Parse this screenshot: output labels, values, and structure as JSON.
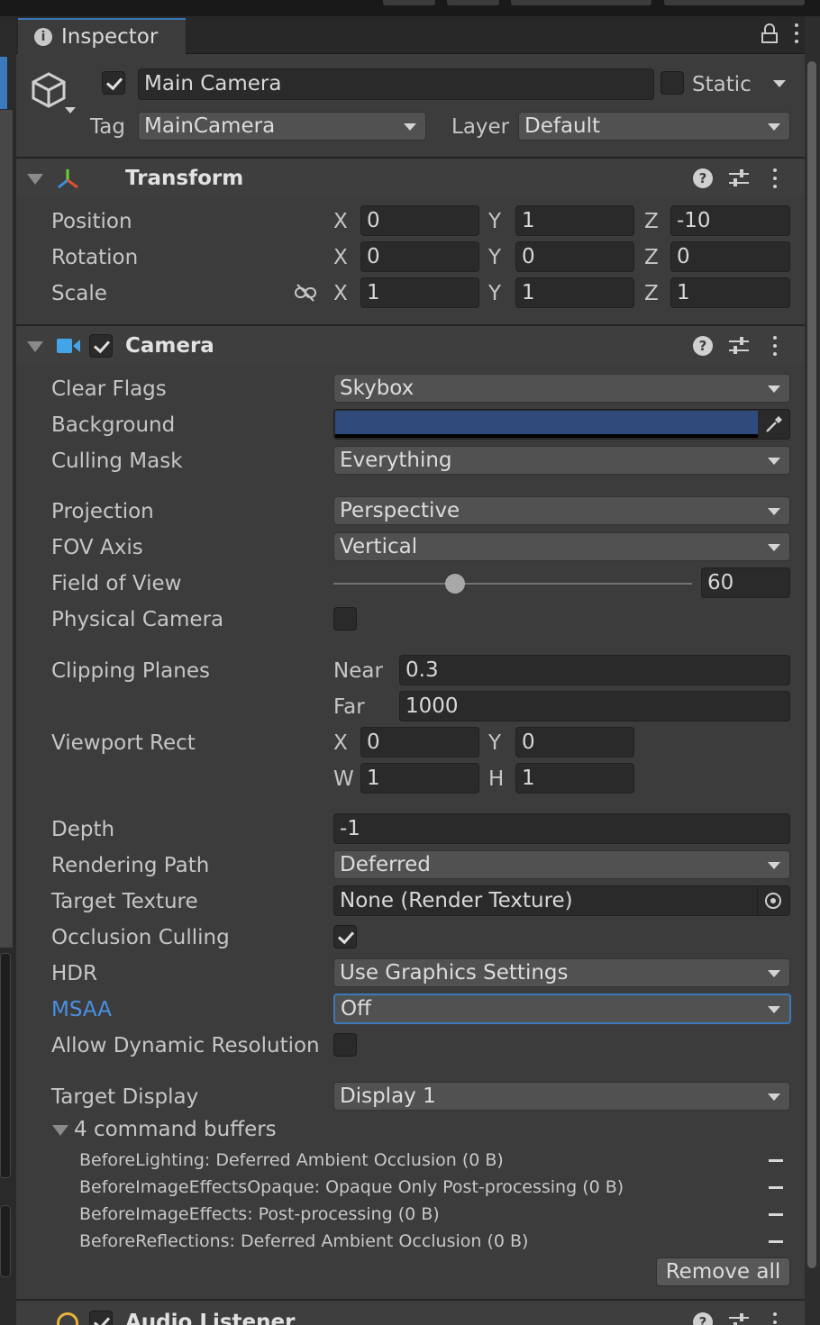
{
  "tab": {
    "label": "Inspector",
    "info_icon": "i"
  },
  "object": {
    "name": "Main Camera",
    "active": true,
    "static_label": "Static",
    "static": false,
    "tag_label": "Tag",
    "tag_value": "MainCamera",
    "layer_label": "Layer",
    "layer_value": "Default"
  },
  "transform": {
    "title": "Transform",
    "position": {
      "label": "Position",
      "x": "0",
      "y": "1",
      "z": "-10"
    },
    "rotation": {
      "label": "Rotation",
      "x": "0",
      "y": "0",
      "z": "0"
    },
    "scale": {
      "label": "Scale",
      "x": "1",
      "y": "1",
      "z": "1"
    },
    "axes": {
      "x": "X",
      "y": "Y",
      "z": "Z"
    }
  },
  "camera": {
    "title": "Camera",
    "enabled": true,
    "clear_flags": {
      "label": "Clear Flags",
      "value": "Skybox"
    },
    "background": {
      "label": "Background",
      "color": "#2f4a7b"
    },
    "culling_mask": {
      "label": "Culling Mask",
      "value": "Everything"
    },
    "projection": {
      "label": "Projection",
      "value": "Perspective"
    },
    "fov_axis": {
      "label": "FOV Axis",
      "value": "Vertical"
    },
    "fov": {
      "label": "Field of View",
      "value": "60",
      "slider_fraction": 0.34
    },
    "physical_camera": {
      "label": "Physical Camera",
      "checked": false
    },
    "clipping": {
      "label": "Clipping Planes",
      "near_label": "Near",
      "near": "0.3",
      "far_label": "Far",
      "far": "1000"
    },
    "viewport": {
      "label": "Viewport Rect",
      "x_label": "X",
      "x": "0",
      "y_label": "Y",
      "y": "0",
      "w_label": "W",
      "w": "1",
      "h_label": "H",
      "h": "1"
    },
    "depth": {
      "label": "Depth",
      "value": "-1"
    },
    "rendering_path": {
      "label": "Rendering Path",
      "value": "Deferred"
    },
    "target_texture": {
      "label": "Target Texture",
      "value": "None (Render Texture)"
    },
    "occlusion_culling": {
      "label": "Occlusion Culling",
      "checked": true
    },
    "hdr": {
      "label": "HDR",
      "value": "Use Graphics Settings"
    },
    "msaa": {
      "label": "MSAA",
      "value": "Off",
      "label_color": "#4a90e2"
    },
    "dynamic_resolution": {
      "label": "Allow Dynamic Resolution",
      "checked": false
    },
    "target_display": {
      "label": "Target Display",
      "value": "Display 1"
    },
    "command_buffers": {
      "header": "4 command buffers",
      "items": [
        "BeforeLighting: Deferred Ambient Occlusion (0 B)",
        "BeforeImageEffectsOpaque: Opaque Only Post-processing (0 B)",
        "BeforeImageEffects: Post-processing (0 B)",
        "BeforeReflections: Deferred Ambient Occlusion (0 B)"
      ],
      "remove_all": "Remove all"
    }
  },
  "audio_listener": {
    "title": "Audio Listener",
    "enabled": true
  },
  "colors": {
    "accent": "#3a79bb",
    "panel": "#3c3c3c",
    "field": "#2a2a2a"
  },
  "icons": [
    "info-icon",
    "lock-icon",
    "kebab-icon",
    "cube-icon",
    "transform-icon",
    "camera-icon",
    "help-icon",
    "preset-icon",
    "eyedropper-icon",
    "object-picker-icon",
    "unlink-icon",
    "audio-listener-icon"
  ]
}
